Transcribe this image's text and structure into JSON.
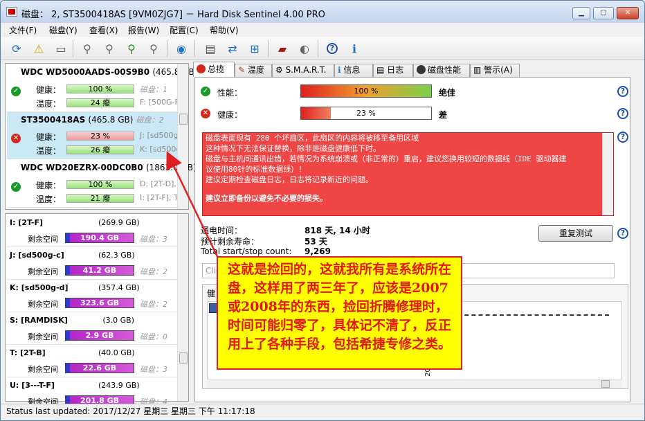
{
  "window": {
    "title": "磁盘： 2, ST3500418AS [9VM0ZJG7] － Hard Disk Sentinel 4.00 PRO"
  },
  "menu": [
    "文件(F)",
    "磁盘(Y)",
    "查看(X)",
    "报告(W)",
    "配置(C)",
    "帮助(V)"
  ],
  "disks": [
    {
      "name": "WDC WD5000AADS-00S9B0",
      "size": "(465.8 GB)",
      "health_label": "健康：",
      "health": "100 %",
      "health_value": 100,
      "temp_label": "温度：",
      "temp": "24 癈",
      "side1": "磁盘：1",
      "side2": "F: [500G-F"
    },
    {
      "name": "ST3500418AS",
      "size": "(465.8 GB)",
      "disk_no": "磁盘：2",
      "health_label": "健康：",
      "health": "23 %",
      "health_value": 23,
      "temp_label": "温度：",
      "temp": "26 癈",
      "side1": "J: [sd500g-",
      "side2": "K: [sd500g"
    },
    {
      "name": "WDC WD20EZRX-00DC0B0",
      "size": "(1863.0 GB)",
      "health_label": "健康：",
      "health": "100 %",
      "health_value": 100,
      "temp_label": "温度：",
      "temp": "21 癈",
      "side1": "D: [2T-D],",
      "side2": "I: [2T-F], T"
    }
  ],
  "volumes": [
    {
      "name": "I: [2T-F]",
      "size": "(269.9 GB)",
      "free_label": "剩余空间",
      "free": "190.4 GB",
      "disk": "磁盘：3"
    },
    {
      "name": "J: [sd500g-c]",
      "size": "(62.3 GB)",
      "free_label": "剩余空间",
      "free": "41.2 GB",
      "disk": "磁盘：2"
    },
    {
      "name": "K: [sd500g-d]",
      "size": "(357.4 GB)",
      "free_label": "剩余空间",
      "free": "323.6 GB",
      "disk": "磁盘：2"
    },
    {
      "name": "S: [RAMDISK]",
      "size": "(3.0 GB)",
      "free_label": "剩余空间",
      "free": "2.9 GB",
      "disk": "磁盘：0"
    },
    {
      "name": "T: [2T-B]",
      "size": "(40.0 GB)",
      "free_label": "剩余空间",
      "free": "22.6 GB",
      "disk": "磁盘：3"
    },
    {
      "name": "U: [3---T-F]",
      "size": "(243.9 GB)",
      "free_label": "剩余空间",
      "free": "201.8 GB",
      "disk": "磁盘：4"
    }
  ],
  "tabs": [
    "总揽",
    "温度",
    "S.M.A.R.T.",
    "信息",
    "日志",
    "磁盘性能",
    "警示(A)"
  ],
  "performance": {
    "label": "性能：",
    "value": "100 %",
    "fraction": 1.0,
    "rating": "绝佳"
  },
  "health": {
    "label": "健康：",
    "value": "23 %",
    "fraction": 0.23,
    "rating": "差"
  },
  "alert": {
    "lines": [
      "磁盘表面现有 280 个坏扇区，此扇区的内容将被移至备用区域",
      "这种情况下无法保证替换，除非是磁盘健康低下时。",
      "磁盘与主机间通讯出错，若情况为系统崩溃或（非正常的）重启，建议您换用较短的数据线（IDE 驱动器建",
      "议使用80针的标准数据线）！",
      "建议定期检查磁盘日志，日志将记录新近的问题。"
    ],
    "bold": "建议立即备份以避免不必要的损失。"
  },
  "info": {
    "poweron_label": "通电时间：",
    "poweron": "818 天, 14 小时",
    "life_label": "预计剩余寿命：",
    "life": "53 天",
    "ss_label": "Total start/stop count:",
    "ss": "9,269"
  },
  "retest_button": "重复测试",
  "comment_placeholder": "Clic",
  "subtab": "健",
  "graph_label": "20",
  "callout": "这就是捡回的，这就我所有是系统所在盘，这样用了两三年了，应该是2007或2008年的东西，捡回折腾修理时，时间可能归零了，具体记不清了，反正用上了各种手段，包括希捷专修之类。",
  "status": "Status last updated: 2017/12/27 星期三 星期三 下午 11:17:18",
  "colors": {
    "bad": "#ef4545",
    "good": "#1a9a2a",
    "callout_bg": "#ffff00",
    "callout_text": "#e01818"
  }
}
